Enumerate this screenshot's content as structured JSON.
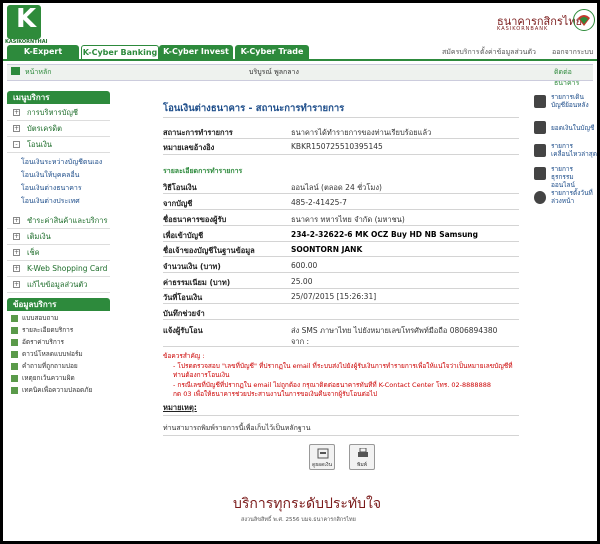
{
  "brand": {
    "logo_letter": "K",
    "logo_text": "KASIKORNTHAI",
    "bank_name_th": "ธนาคารกสิกรไทย",
    "bank_name_en": "KASIKORNBANK",
    "primary_color": "#2d8a3c",
    "accent_color": "#7a1a1a"
  },
  "nav": {
    "tabs": [
      {
        "label": "K-Expert MyPort",
        "active": false
      },
      {
        "label": "K-Cyber Banking",
        "active": true
      },
      {
        "label": "K-Cyber Invest",
        "active": false
      },
      {
        "label": "K-Cyber Trade",
        "active": false
      }
    ],
    "links": [
      "สมัครบริการ",
      "ตั้งค่าข้อมูลส่วนตัว",
      "ออกจากระบบ"
    ]
  },
  "status": {
    "home": "หน้าหลัก",
    "user": "บริบูรณ์ พูลกลาง",
    "contact": "ติดต่อธนาคาร"
  },
  "sidebar": {
    "menu_title": "เมนูบริการ",
    "menu": [
      {
        "label": "การบริหารบัญชี",
        "expand": "+"
      },
      {
        "label": "บัตรเครดิต",
        "expand": "+"
      },
      {
        "label": "โอนเงิน",
        "expand": "-"
      }
    ],
    "transfer_sub": [
      "โอนเงินระหว่างบัญชีตนเอง",
      "โอนเงินให้บุคคลอื่น",
      "โอนเงินต่างธนาคาร",
      "โอนเงินต่างประเทศ"
    ],
    "menu2": [
      {
        "label": "ชำระค่าสินค้าและบริการ",
        "expand": "+"
      },
      {
        "label": "เติมเงิน",
        "expand": "+"
      },
      {
        "label": "เช็ค",
        "expand": "+"
      },
      {
        "label": "K-Web Shopping Card",
        "expand": "+"
      },
      {
        "label": "แก้ไขข้อมูลส่วนตัว",
        "expand": "+"
      }
    ],
    "services_title": "ข้อมูลบริการ",
    "services": [
      "แบบสอบถาม",
      "รายละเอียดบริการ",
      "อัตราค่าบริการ",
      "ดาวน์โหลดแบบฟอร์ม",
      "คำถามที่ถูกถามบ่อย",
      "เหตุยกเว้นความผิด",
      "เทคนิคเพื่อความปลอดภัย"
    ]
  },
  "main": {
    "title": "โอนเงินต่างธนาคาร - สถานะการทำรายการ",
    "status_label": "สถานะการทำรายการ",
    "status_value": "ธนาคารได้ทำรายการของท่านเรียบร้อยแล้ว",
    "ref_label": "หมายเลขอ้างอิง",
    "ref_value": "KBKR150725510395145",
    "section_title": "รายละเอียดการทำรายการ",
    "rows": [
      {
        "label": "วิธีโอนเงิน",
        "value": "ออนไลน์ (ตลอด 24 ชั่วโมง)",
        "vbold": false
      },
      {
        "label": "จากบัญชี",
        "value": "485-2-41425-7",
        "vbold": false
      },
      {
        "label": "ชื่อธนาคารของผู้รับ",
        "value": "ธนาคาร ทหารไทย จำกัด (มหาชน)",
        "vbold": false
      },
      {
        "label": "เพื่อเข้าบัญชี",
        "value": "234-2-32622-6 MK OCZ Buy HD NB Samsung",
        "vbold": true
      },
      {
        "label": "ชื่อเจ้าของบัญชีในฐานข้อมูล",
        "value": "SOONTORN JANK",
        "vbold": true
      },
      {
        "label": "จำนวนเงิน (บาท)",
        "value": "600.00",
        "vbold": false
      },
      {
        "label": "ค่าธรรมเนียม (บาท)",
        "value": "25.00",
        "vbold": false
      },
      {
        "label": "วันที่โอนเงิน",
        "value": "25/07/2015 [15:26:31]",
        "vbold": false
      },
      {
        "label": "บันทึกช่วยจำ",
        "value": "",
        "vbold": false
      },
      {
        "label": "แจ้งผู้รับโอน",
        "value": "ส่ง SMS ภาษาไทย ไปยังหมายเลขโทรศัพท์มือถือ 0806894380",
        "vbold": false
      }
    ],
    "notify_from": "จาก :",
    "important_label": "ข้อควรสำคัญ :",
    "important_lines": [
      "- โปรดตรวจสอบ \"เลขที่บัญชี\" ที่ปรากฏใน email ที่ระบบส่งไปยังผู้รับเงินการทำรายการเพื่อให้แน่ใจว่าเป็นหมายเลขบัญชีที่",
      "ท่านต้องการโอนเงิน",
      "- กรณีเลขที่บัญชีที่ปรากฏใน email ไม่ถูกต้อง กรุณาติดต่อธนาคารทันทีที่ K-Contact Center โทร. 02-8888888",
      "กด 03 เพื่อให้ธนาคารช่วยประสานงานในการขอเงินคืนจากผู้รับโอนต่อไป"
    ],
    "remark_title": "หมายเหตุ:",
    "remark_text": "ท่านสามารถพิมพ์รายการนี้เพื่อเก็บไว้เป็นหลักฐาน",
    "buttons": [
      "ดูยอดเงิน",
      "พิมพ์"
    ]
  },
  "right_shortcuts": [
    [
      "รายการเดิน",
      "บัญชีย้อนหลัง"
    ],
    [
      "ยอดเงินในบัญชี"
    ],
    [
      "รายการ",
      "เคลื่อนไหวล่าสุด"
    ],
    [
      "รายการ",
      "ธุรกรรมออนไลน์"
    ],
    [
      "รายการตั้งวันที่",
      "ล่วงหน้า"
    ]
  ],
  "footer": {
    "title": "บริการทุกระดับประทับใจ",
    "copyright": "สงวนลิขสิทธิ์ พ.ศ. 2556 บมจ.ธนาคารกสิกรไทย"
  },
  "watermark": "[941x825] http://upic.me/"
}
